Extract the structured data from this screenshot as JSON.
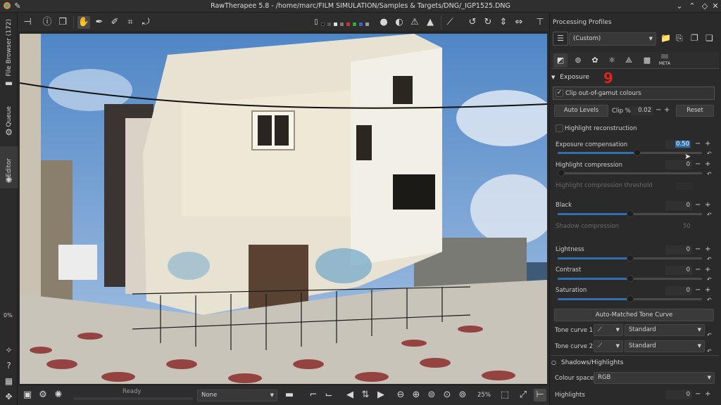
{
  "window": {
    "title": "RawTherapee 5.8 - /home/marc/FILM SIMULATION/Samples & Targets/DNG/_IGP1525.DNG"
  },
  "left_tabs": {
    "file_browser": "File Browser (172)",
    "queue": "Queue",
    "editor": "Editor",
    "progress": "0%"
  },
  "bottom": {
    "status": "Ready",
    "profile_select": "None",
    "zoom": "25%"
  },
  "right": {
    "processing_profiles_label": "Processing Profiles",
    "profile_value": "(Custom)",
    "step_marker": "9",
    "exposure": {
      "header": "Exposure",
      "clip_label": "Clip out-of-gamut colours",
      "auto_levels": "Auto Levels",
      "clip_pct_label": "Clip %",
      "clip_pct_value": "0.02",
      "reset": "Reset",
      "highlight_reconstruction": "Highlight reconstruction",
      "exposure_comp_label": "Exposure compensation",
      "exposure_comp_value": "0.50",
      "highlight_comp_label": "Highlight compression",
      "highlight_comp_value": "0",
      "highlight_threshold_label": "Highlight compression threshold",
      "black_label": "Black",
      "black_value": "0",
      "shadow_comp_label": "Shadow compression",
      "shadow_comp_value": "50",
      "lightness_label": "Lightness",
      "lightness_value": "0",
      "contrast_label": "Contrast",
      "contrast_value": "0",
      "saturation_label": "Saturation",
      "saturation_value": "0",
      "auto_matched": "Auto-Matched Tone Curve",
      "tone_curve_1_label": "Tone curve 1:",
      "tone_curve_1_value": "Standard",
      "tone_curve_2_label": "Tone curve 2:",
      "tone_curve_2_value": "Standard"
    },
    "shadows_highlights": {
      "header": "Shadows/Highlights",
      "colour_space_label": "Colour space:",
      "colour_space_value": "RGB",
      "highlights_label": "Highlights",
      "highlights_value": "0"
    }
  },
  "slider_levels": {
    "exposure_comp": 0.55,
    "highlight_comp": 0.0,
    "black": 0.5,
    "lightness": 0.5,
    "contrast": 0.5,
    "saturation": 0.5
  },
  "colors": {
    "accent": "#2f6fb0",
    "marker": "#e0241b",
    "panel": "#2a2a2a"
  },
  "icons": {
    "toolbar": [
      "crop-tool-icon",
      "info-icon",
      "before-after-icon",
      "hand-icon",
      "picker-icon",
      "spot-icon",
      "crop-icon",
      "straighten-icon"
    ],
    "tab_icons": [
      "exposure-tab-icon",
      "detail-tab-icon",
      "color-tab-icon",
      "advanced-tab-icon",
      "transform-tab-icon",
      "raw-tab-icon",
      "meta-tab-icon"
    ]
  }
}
